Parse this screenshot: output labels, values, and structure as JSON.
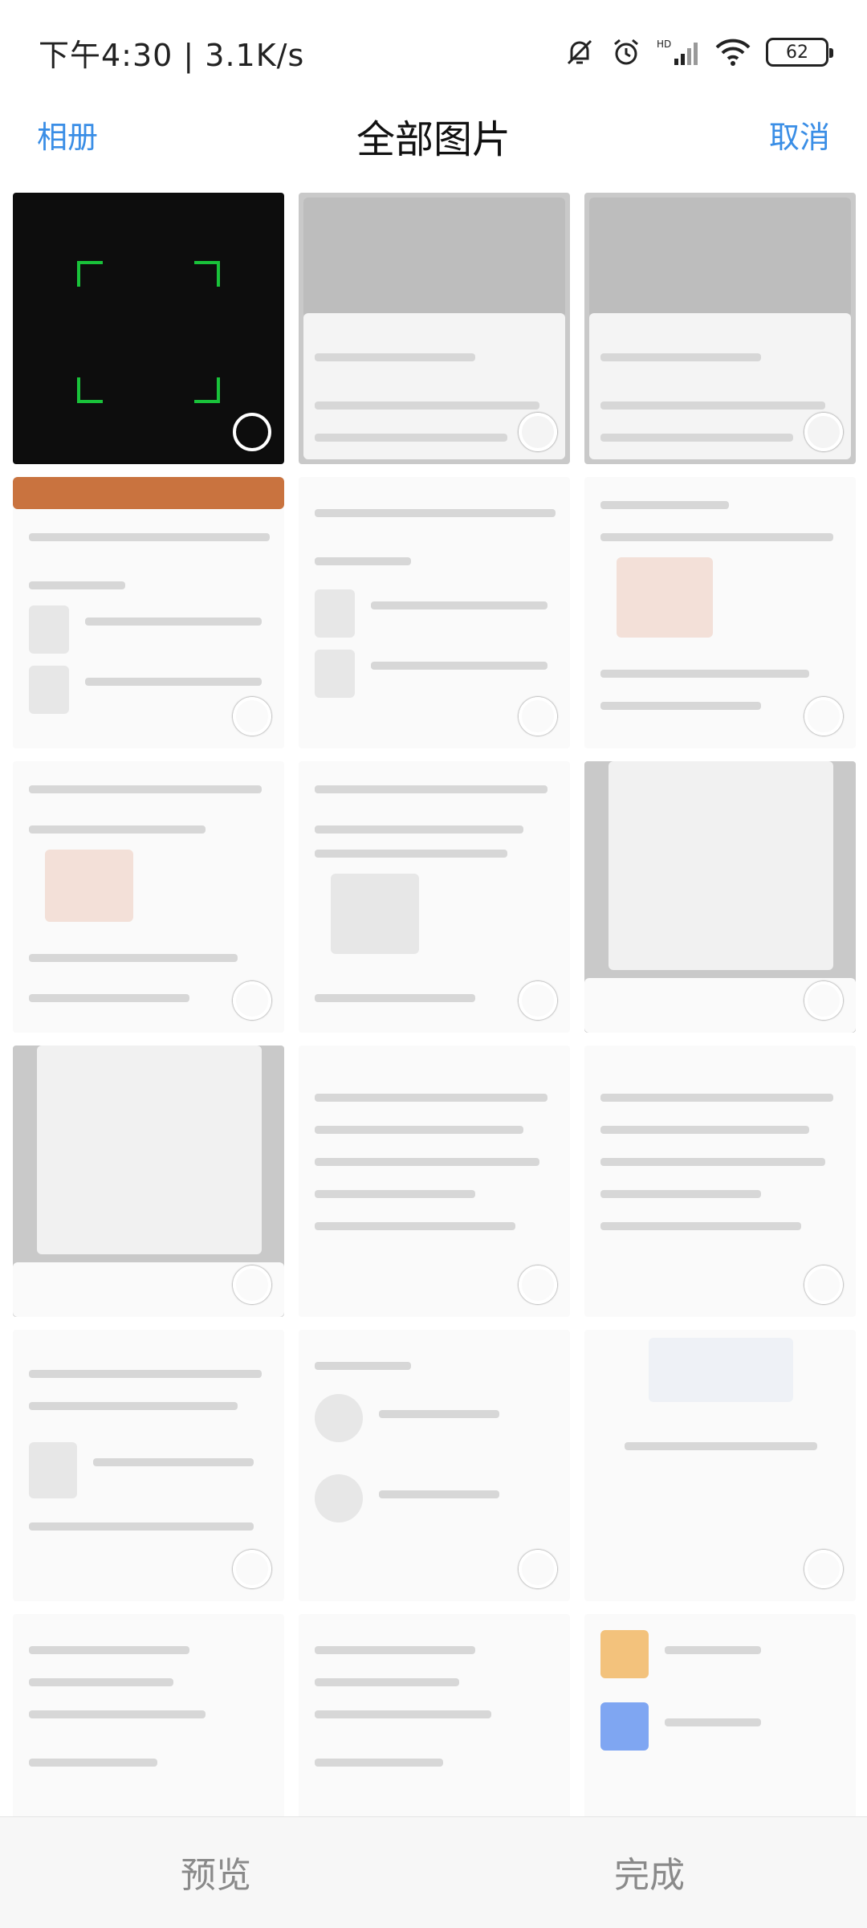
{
  "status_bar": {
    "time_text": "下午4:30 | 3.1K/s",
    "battery": "62",
    "icons": [
      "mute-bell-icon",
      "alarm-icon",
      "signal-hd-icon",
      "wifi-icon",
      "battery-icon"
    ]
  },
  "nav": {
    "left_label": "相册",
    "title": "全部图片",
    "right_label": "取消",
    "accent": "#3a8ee6"
  },
  "grid": {
    "thumb_count": 15
  },
  "bottom": {
    "preview_label": "预览",
    "done_label": "完成"
  },
  "thumbs": [
    {
      "name": "thumb-scanner",
      "style": "dark"
    },
    {
      "name": "thumb-share-menu-1",
      "style": "grey"
    },
    {
      "name": "thumb-share-menu-2",
      "style": "grey"
    },
    {
      "name": "thumb-booklist-1",
      "style": "light"
    },
    {
      "name": "thumb-booklist-2",
      "style": "light"
    },
    {
      "name": "thumb-comment-1",
      "style": "light"
    },
    {
      "name": "thumb-comment-2",
      "style": "light"
    },
    {
      "name": "thumb-comment-3",
      "style": "light"
    },
    {
      "name": "thumb-booklist-share-1",
      "style": "grey"
    },
    {
      "name": "thumb-booklist-share-2",
      "style": "grey"
    },
    {
      "name": "thumb-article-1",
      "style": "light"
    },
    {
      "name": "thumb-article-2",
      "style": "light"
    },
    {
      "name": "thumb-article-3",
      "style": "light"
    },
    {
      "name": "thumb-follow-list",
      "style": "light"
    },
    {
      "name": "thumb-empty-state",
      "style": "light"
    },
    {
      "name": "thumb-settings-1",
      "style": "light"
    },
    {
      "name": "thumb-settings-2",
      "style": "light"
    },
    {
      "name": "thumb-settings-3",
      "style": "light"
    }
  ]
}
